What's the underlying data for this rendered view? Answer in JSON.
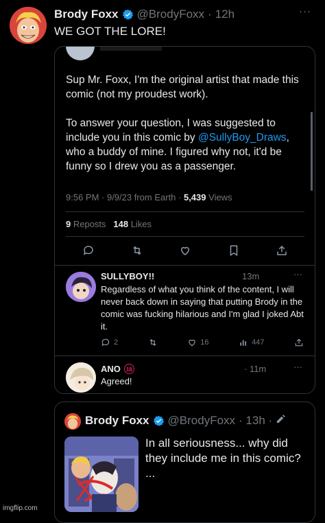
{
  "top_tweet": {
    "name": "Brody Foxx",
    "handle": "@BrodyFoxx",
    "dot": "·",
    "time": "12h",
    "text": "WE GOT THE LORE!",
    "more": "···"
  },
  "reply_tweet": {
    "para1": "Sup Mr. Foxx, I'm the original artist that made this comic (not my proudest work).",
    "para2_before": "To answer your question, I was suggested to include you in this comic by ",
    "mention": "@SullyBoy_Draws",
    "para2_after": ", who a buddy of mine. I figured why not, it'd be funny so I drew you as a passenger.",
    "meta_time": "9:56 PM · 9/9/23 from Earth · ",
    "views_count": "5,439",
    "views_label": " Views",
    "reposts_count": "9",
    "reposts_label": " Reposts",
    "likes_count": "148",
    "likes_label": " Likes"
  },
  "replies": [
    {
      "name": "SULLYBOY!!",
      "time": "13m",
      "more": "···",
      "text": "Regardless of what you think of the content, I will never back down in saying that putting Brody in the comic was fucking hilarious and I'm glad I joked Abt it.",
      "replies_count": "2",
      "likes_count": "16",
      "views_count": "447"
    },
    {
      "name": "ANO",
      "badge": "18",
      "time": "· 11m",
      "more": "···",
      "text": "Agreed!"
    }
  ],
  "quoted_tweet": {
    "name": "Brody Foxx",
    "handle": "@BrodyFoxx",
    "time": "· 13h ·",
    "text": "In all seriousness... why did they include me in this comic?",
    "ellipsis": "..."
  },
  "watermark": "imgflip.com",
  "colors": {
    "background": "#000000",
    "accent": "#1d9bf0",
    "muted": "#71767b",
    "border": "#2f3336"
  }
}
